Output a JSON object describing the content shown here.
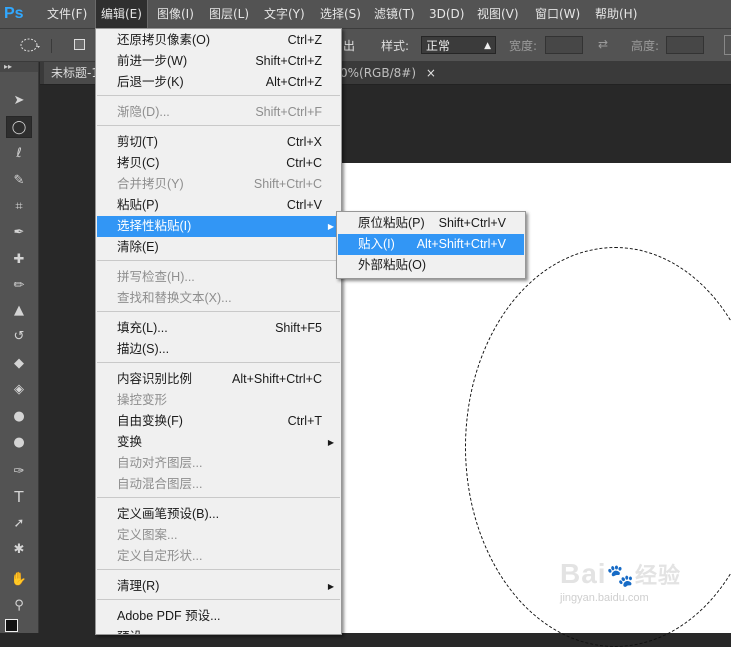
{
  "app": {
    "logo": "Ps",
    "accent": "#31a8ff"
  },
  "menubar": {
    "items": [
      "文件(F)",
      "编辑(E)",
      "图像(I)",
      "图层(L)",
      "文字(Y)",
      "选择(S)",
      "滤镜(T)",
      "3D(D)",
      "视图(V)",
      "窗口(W)",
      "帮助(H)"
    ],
    "active_index": 1
  },
  "options_bar": {
    "hidden_label_fragment": "出",
    "style_label": "样式:",
    "style_value": "正常",
    "width_label": "宽度:",
    "height_label": "高度:"
  },
  "document": {
    "tab_title": "未标题-1",
    "tab_tail": "0%(RGB/8#)",
    "tab_close": "×"
  },
  "edit_menu": {
    "items": [
      {
        "label": "还原拷贝像素(O)",
        "shortcut": "Ctrl+Z",
        "disabled": false
      },
      {
        "label": "前进一步(W)",
        "shortcut": "Shift+Ctrl+Z",
        "disabled": false
      },
      {
        "label": "后退一步(K)",
        "shortcut": "Alt+Ctrl+Z",
        "disabled": false
      },
      {
        "label": "渐隐(D)...",
        "shortcut": "Shift+Ctrl+F",
        "disabled": true
      },
      {
        "label": "剪切(T)",
        "shortcut": "Ctrl+X",
        "disabled": false
      },
      {
        "label": "拷贝(C)",
        "shortcut": "Ctrl+C",
        "disabled": false
      },
      {
        "label": "合并拷贝(Y)",
        "shortcut": "Shift+Ctrl+C",
        "disabled": true
      },
      {
        "label": "粘贴(P)",
        "shortcut": "Ctrl+V",
        "disabled": false
      },
      {
        "label": "选择性粘贴(I)",
        "shortcut": "",
        "disabled": false,
        "submenu": true,
        "highlighted": true
      },
      {
        "label": "清除(E)",
        "shortcut": "",
        "disabled": false
      },
      {
        "label": "拼写检查(H)...",
        "shortcut": "",
        "disabled": true
      },
      {
        "label": "查找和替换文本(X)...",
        "shortcut": "",
        "disabled": true
      },
      {
        "label": "填充(L)...",
        "shortcut": "Shift+F5",
        "disabled": false
      },
      {
        "label": "描边(S)...",
        "shortcut": "",
        "disabled": false
      },
      {
        "label": "内容识别比例",
        "shortcut": "Alt+Shift+Ctrl+C",
        "disabled": false
      },
      {
        "label": "操控变形",
        "shortcut": "",
        "disabled": true
      },
      {
        "label": "自由变换(F)",
        "shortcut": "Ctrl+T",
        "disabled": false
      },
      {
        "label": "变换",
        "shortcut": "",
        "disabled": false,
        "submenu": true
      },
      {
        "label": "自动对齐图层...",
        "shortcut": "",
        "disabled": true
      },
      {
        "label": "自动混合图层...",
        "shortcut": "",
        "disabled": true
      },
      {
        "label": "定义画笔预设(B)...",
        "shortcut": "",
        "disabled": false
      },
      {
        "label": "定义图案...",
        "shortcut": "",
        "disabled": true
      },
      {
        "label": "定义自定形状...",
        "shortcut": "",
        "disabled": true
      },
      {
        "label": "清理(R)",
        "shortcut": "",
        "disabled": false,
        "submenu": true
      },
      {
        "label": "Adobe PDF 预设...",
        "shortcut": "",
        "disabled": false
      },
      {
        "label": "预设",
        "shortcut": "",
        "disabled": false,
        "submenu": true
      }
    ]
  },
  "paste_special_menu": {
    "items": [
      {
        "label": "原位粘贴(P)",
        "shortcut": "Shift+Ctrl+V",
        "highlighted": false
      },
      {
        "label": "贴入(I)",
        "shortcut": "Alt+Shift+Ctrl+V",
        "highlighted": true
      },
      {
        "label": "外部粘贴(O)",
        "shortcut": "",
        "highlighted": false
      }
    ]
  },
  "tools": [
    "move-tool-icon",
    "elliptical-marquee-tool-icon",
    "lasso-tool-icon",
    "quick-selection-tool-icon",
    "crop-tool-icon",
    "eyedropper-tool-icon",
    "healing-brush-tool-icon",
    "brush-tool-icon",
    "clone-stamp-tool-icon",
    "history-brush-tool-icon",
    "eraser-tool-icon",
    "paint-bucket-tool-icon",
    "blur-tool-icon",
    "dodge-tool-icon",
    "pen-tool-icon",
    "type-tool-icon",
    "path-selection-tool-icon",
    "custom-shape-tool-icon",
    "hand-tool-icon",
    "zoom-tool-icon"
  ],
  "watermark": {
    "logo": "Bai",
    "logo_suffix": "经验",
    "url": "jingyan.baidu.com"
  },
  "colors": {
    "highlight": "#3296f5",
    "menu_bg": "#f0f0f0",
    "chrome": "#535353",
    "workspace": "#282828"
  }
}
